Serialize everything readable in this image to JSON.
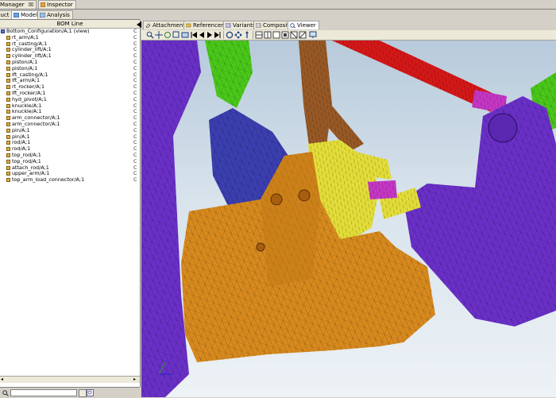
{
  "top_tabs": [
    {
      "label": "Manager",
      "close": "☒"
    },
    {
      "label": "Inspector"
    }
  ],
  "sub_tabs": [
    {
      "label": "duct"
    },
    {
      "label": "Model"
    },
    {
      "label": "Analysis"
    }
  ],
  "bom": {
    "header": "BOM Line",
    "root": "Bottom_Configuration/A;1 (view)",
    "items": [
      "rt_arm/A;1",
      "rt_casting/A;1",
      "cylinder_lift/A;1",
      "cylinder_lift/A;1",
      "piston/A;1",
      "piston/A;1",
      "lft_casting/A;1",
      "lft_arm/A;1",
      "rt_rocker/A;1",
      "lft_rocker/A;1",
      "hyd_pivot/A;1",
      "knuckle/A;1",
      "knuckle/A;1",
      "arm_connector/A;1",
      "arm_connector/A;1",
      "pin/A;1",
      "pin/A;1",
      "rod/A;1",
      "rod/A;1",
      "top_rod/A;1",
      "top_rod/A;1",
      "attach_rod/A;1",
      "upper_arm/A;1",
      "top_arm_load_connector/A;1"
    ],
    "col_marker": "C"
  },
  "right_tabs": [
    "Attachments",
    "Referencers",
    "Variants",
    "Composite",
    "Viewer"
  ],
  "active_right_tab": "Viewer",
  "search": {
    "value": ""
  },
  "toolbar_icons": [
    "zoom-icon",
    "pan-icon",
    "rotate-icon",
    "zoom-box-icon",
    "fit-icon",
    "first-icon",
    "prev-icon",
    "next-icon",
    "last-icon",
    "refresh-icon",
    "move-icon",
    "up-down-icon",
    "view-1-icon",
    "view-2-icon",
    "view-3-icon",
    "view-4-icon",
    "view-5-icon",
    "view-6-icon",
    "screen-icon"
  ],
  "colors": {
    "part_orange": "#d88a1e",
    "part_purple": "#6a30c8",
    "part_blue": "#3b3fb0",
    "part_yellow": "#e8e23a",
    "part_brown": "#9a5a26",
    "part_red": "#d81818",
    "part_green": "#4ac81a",
    "part_magenta": "#c838c8"
  }
}
